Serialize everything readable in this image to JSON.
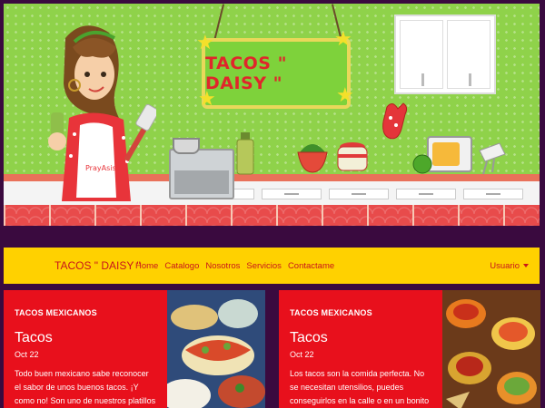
{
  "hero": {
    "sign_text": "TACOS \" DAISY \"",
    "apron_text": "PrayAsisi",
    "colors": {
      "wall": "#8fd24a",
      "sign": "#7ed23b",
      "sign_text": "#e0262b",
      "tiles": "#e84b4b"
    }
  },
  "navbar": {
    "brand": "TACOS \" DAISY \"",
    "links": [
      "Home",
      "Catalogo",
      "Nosotros",
      "Servicios",
      "Contactame"
    ],
    "user_menu": "Usuario",
    "colors": {
      "background": "#ffd100",
      "text": "#c8151b"
    }
  },
  "cards": [
    {
      "label": "TACOS MEXICANOS",
      "title": "Tacos",
      "date": "Oct 22",
      "text": "Todo buen mexicano sabe reconocer el sabor de unos buenos tacos. ¡Y como no! Son uno de nuestros platillos nacionales"
    },
    {
      "label": "TACOS MEXICANOS",
      "title": "Tacos",
      "date": "Oct 22",
      "text": "Los tacos son la comida perfecta. No se necesitan utensilios, puedes conseguirlos en la calle o en un bonito restaurante"
    }
  ],
  "page_background": "#3a0a3f",
  "card_color": "#e8101c"
}
